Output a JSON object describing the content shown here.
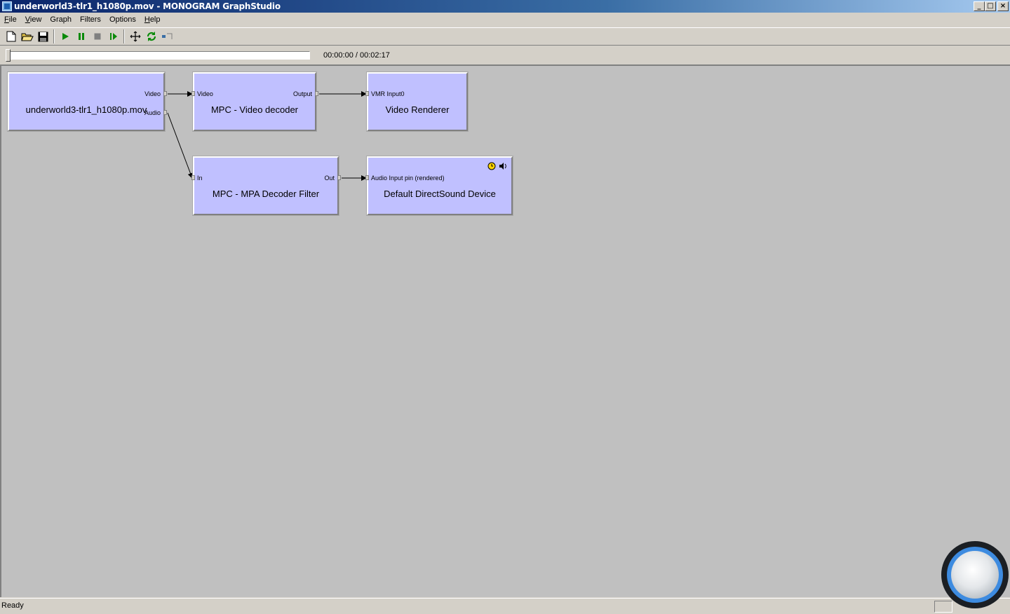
{
  "window": {
    "title": "underworld3-tlr1_h1080p.mov - MONOGRAM GraphStudio",
    "buttons": {
      "minimize": "_",
      "maximize": "□",
      "close": "×"
    }
  },
  "menu": [
    {
      "label": "File",
      "accel": "F",
      "rest": "ile"
    },
    {
      "label": "View",
      "accel": "V",
      "rest": "iew"
    },
    {
      "label": "Graph",
      "accel": "",
      "rest": "Graph"
    },
    {
      "label": "Filters",
      "accel": "",
      "rest": "Filters"
    },
    {
      "label": "Options",
      "accel": "",
      "rest": "Options"
    },
    {
      "label": "Help",
      "accel": "H",
      "rest": "elp"
    }
  ],
  "toolbar": {
    "icons": [
      "new-file-icon",
      "open-folder-icon",
      "save-disk-icon",
      "play-icon",
      "pause-icon",
      "stop-icon",
      "frame-step-icon",
      "arrange-icon",
      "refresh-icon",
      "seek-icon"
    ]
  },
  "seek": {
    "position_fraction": 0.0,
    "time": "00:00:00 / 00:02:17"
  },
  "filters": {
    "source": {
      "name": "underworld3-tlr1_h1080p.mov",
      "pins": {
        "video": "Video",
        "audio": "Audio"
      }
    },
    "video_decoder": {
      "name": "MPC - Video decoder",
      "pins": {
        "input": "Video",
        "output": "Output"
      }
    },
    "video_renderer": {
      "name": "Video Renderer",
      "pins": {
        "input": "VMR Input0"
      }
    },
    "audio_decoder": {
      "name": "MPC - MPA Decoder Filter",
      "pins": {
        "input": "In",
        "output": "Out"
      }
    },
    "audio_renderer": {
      "name": "Default DirectSound Device",
      "pins": {
        "input": "Audio Input pin (rendered)"
      },
      "icons": [
        "clock-icon",
        "speaker-icon"
      ]
    }
  },
  "status": {
    "text": "Ready"
  },
  "colors": {
    "filter_fill": "#c0c0ff",
    "canvas": "#c0c0c0",
    "chrome": "#d4d0c8"
  }
}
